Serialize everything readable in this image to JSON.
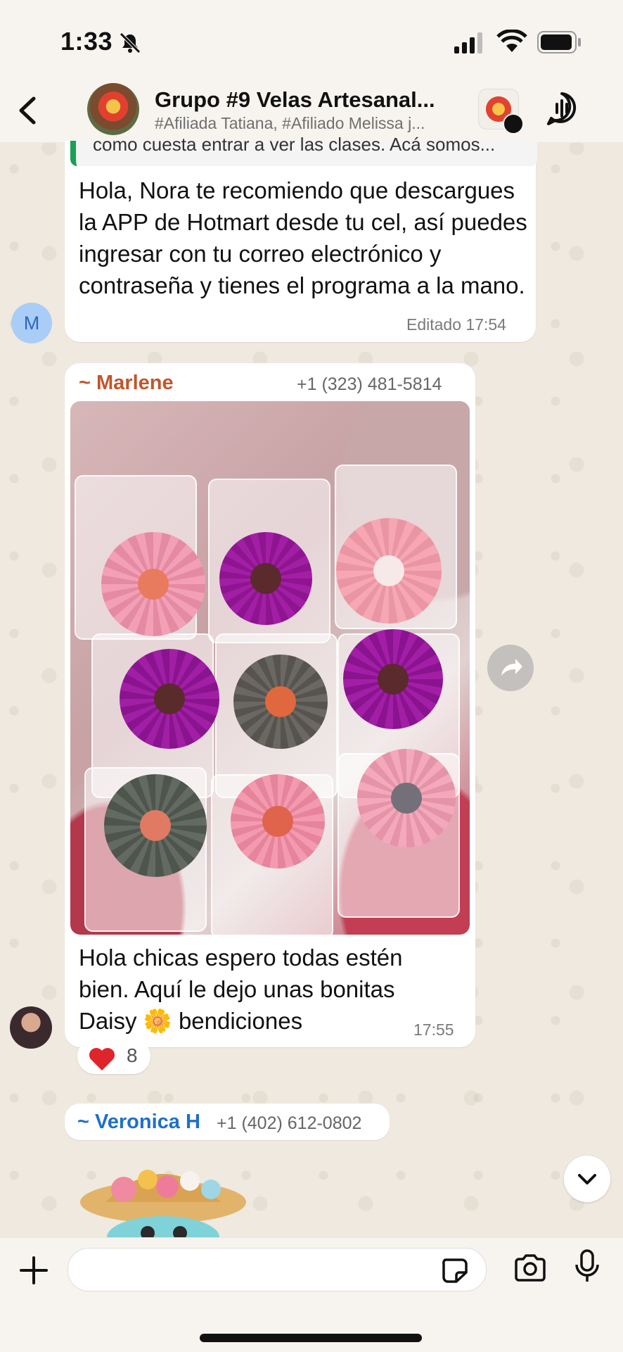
{
  "status_bar": {
    "time": "1:33"
  },
  "header": {
    "title": "Grupo #9 Velas Artesanal...",
    "subtitle": "#Afiliada Tatiana, #Afiliado Melissa j..."
  },
  "messages": [
    {
      "quoted_preview": "como cuesta entrar a ver las clases. Acá somos...",
      "text": "Hola, Nora te recomiendo que descargues la APP de Hotmart desde tu cel, así puedes ingresar con tu correo electrónico y contraseña y tienes el programa a la mano.",
      "meta": "Editado 17:54",
      "avatar_letter": "M"
    },
    {
      "sender": "~ Marlene",
      "sender_color": "#c0562c",
      "phone": "+1 (323) 481-5814",
      "text": "Hola chicas espero todas estén bien. Aquí le dejo unas bonitas Daisy 🌼 bendiciones",
      "time": "17:55",
      "reaction": {
        "emoji": "❤️",
        "count": "8"
      }
    },
    {
      "sender": "~ Veronica H",
      "sender_color": "#1f6fc9",
      "phone": "+1 (402) 612-0802"
    }
  ]
}
